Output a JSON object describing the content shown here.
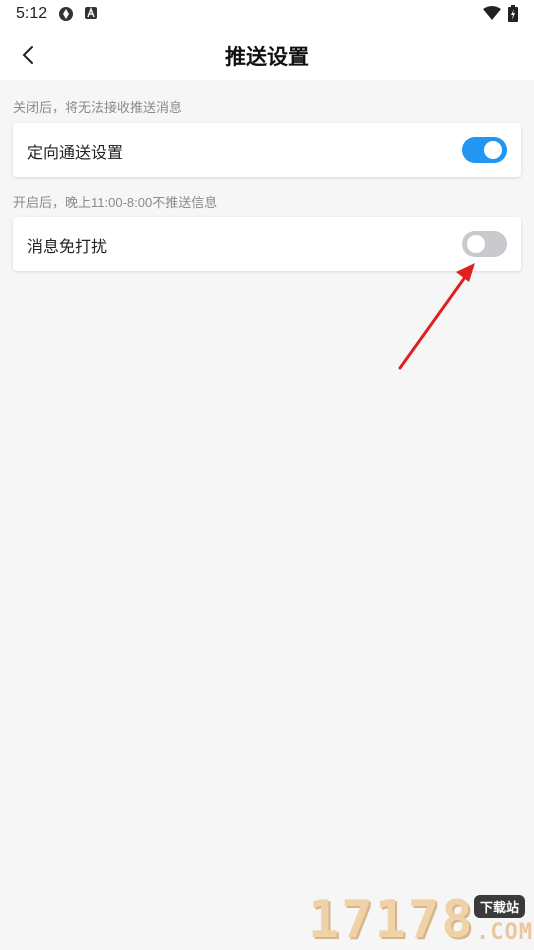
{
  "status_bar": {
    "time": "5:12",
    "icons": [
      "app-notification-icon",
      "text-a-icon",
      "wifi-icon",
      "battery-charging-icon"
    ]
  },
  "header": {
    "title": "推送设置",
    "back_icon": "chevron-left-icon"
  },
  "sections": [
    {
      "hint": "关闭后，将无法接收推送消息",
      "label": "定向通送设置",
      "toggle_on": true
    },
    {
      "hint": "开启后，晚上11:00-8:00不推送信息",
      "label": "消息免打扰",
      "toggle_on": false
    }
  ],
  "annotation": {
    "arrow_color": "#e02020"
  },
  "watermark": {
    "digits": "17178",
    "badge": "下载站",
    "domain": ".COM"
  },
  "colors": {
    "accent": "#2196f3",
    "toggle_off": "#c9cacd",
    "background": "#f6f6f6"
  }
}
